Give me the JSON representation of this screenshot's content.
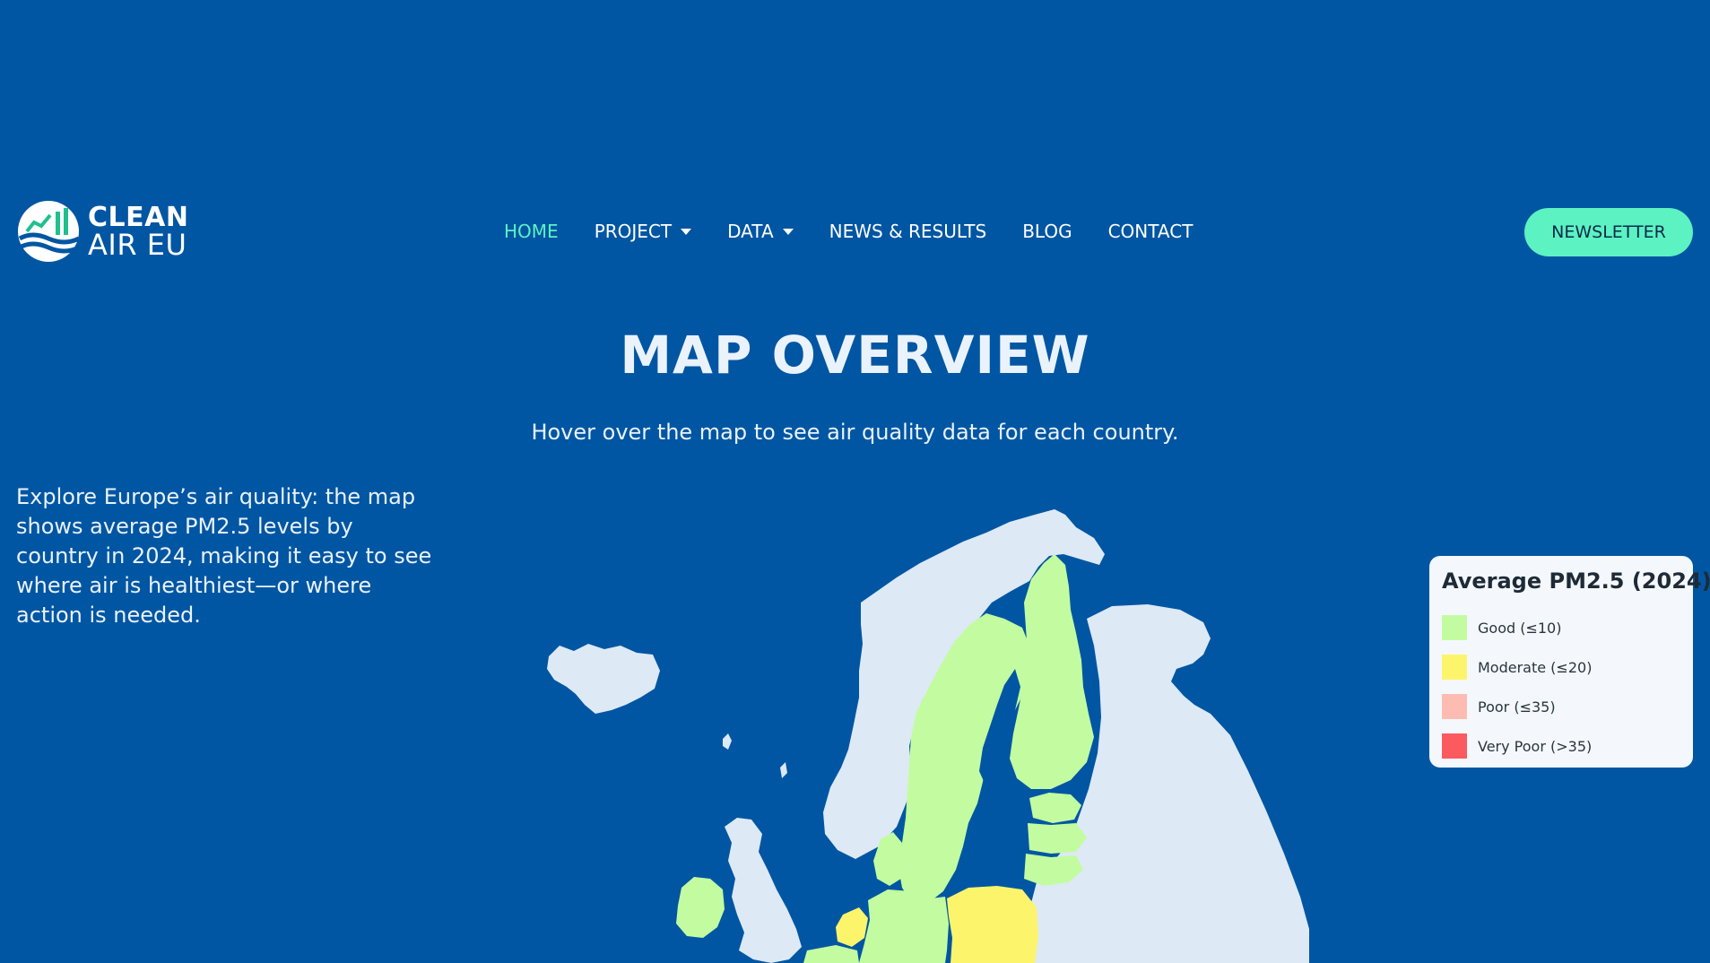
{
  "header": {
    "logo": {
      "line1": "CLEAN",
      "line2": "AIR EU"
    },
    "nav": [
      {
        "label": "HOME",
        "active": true,
        "dropdown": false
      },
      {
        "label": "PROJECT",
        "active": false,
        "dropdown": true
      },
      {
        "label": "DATA",
        "active": false,
        "dropdown": true
      },
      {
        "label": "NEWS & RESULTS",
        "active": false,
        "dropdown": false
      },
      {
        "label": "BLOG",
        "active": false,
        "dropdown": false
      },
      {
        "label": "CONTACT",
        "active": false,
        "dropdown": false
      }
    ],
    "newsletter_label": "NEWSLETTER"
  },
  "main": {
    "title": "MAP OVERVIEW",
    "subtitle": "Hover over the map to see air quality data for each country.",
    "intro": "Explore Europe’s air quality: the map shows average PM2.5 levels by country in 2024, making it easy to see where air is healthiest—or where action is needed."
  },
  "legend": {
    "title": "Average PM2.5 (2024)",
    "items": [
      {
        "label": "Good (≤10)",
        "color": "#c3fca0"
      },
      {
        "label": "Moderate (≤20)",
        "color": "#fcf56b"
      },
      {
        "label": "Poor (≤35)",
        "color": "#fcbcb2"
      },
      {
        "label": "Very Poor (>35)",
        "color": "#fb5b5e"
      }
    ]
  },
  "colors": {
    "background": "#0056a3",
    "accent": "#5cf2c2",
    "no_data": "#dde9f5",
    "good": "#c3fca0",
    "moderate": "#fcf56b"
  }
}
